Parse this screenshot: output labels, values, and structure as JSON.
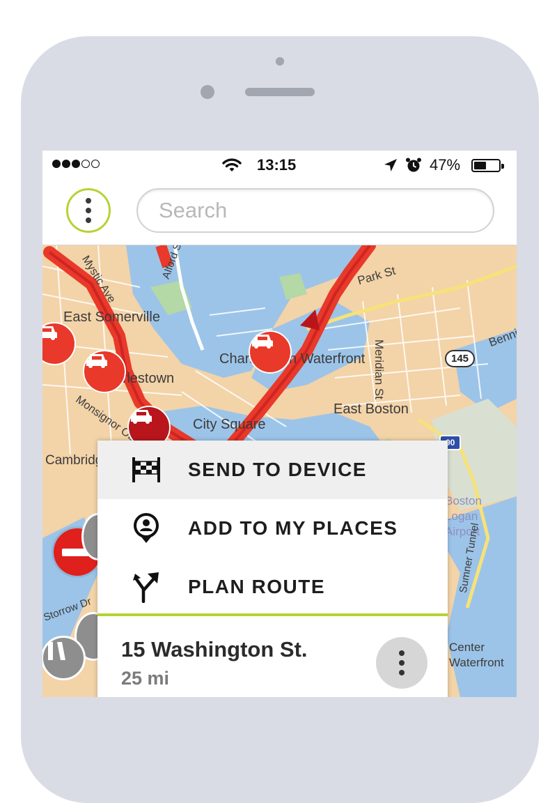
{
  "status_bar": {
    "time": "13:15",
    "battery_percent": "47%",
    "battery_level": 0.47,
    "signal_bars_filled": 3,
    "signal_bars_total": 5,
    "icons": [
      "wifi-icon",
      "location-arrow-icon",
      "alarm-clock-icon",
      "battery-icon"
    ]
  },
  "header": {
    "menu_icon": "more-vertical-icon",
    "search_placeholder": "Search",
    "accent_color": "#b5d334"
  },
  "map": {
    "labels": {
      "east_somerville": "East Somerville",
      "charlestown": "Charlestown",
      "charlestown_waterfront": "Charlestown Waterfront",
      "waterfront": "Waterfront",
      "city_square": "City Square",
      "east_boston": "East Boston",
      "meridian_st": "Meridian St",
      "park_st": "Park St",
      "mystic_ave": "Mystic Ave",
      "monsignor_ob": "Monsignor Ob",
      "cambridge": "Cambridge",
      "storrow_dr": "Storrow Dr",
      "boston_logan_airport": "Boston Logan Airport",
      "sumner_tunnel": "Sumner Tunnel",
      "center_waterfront": "Center Waterfront",
      "bennington": "Benning",
      "alford_st": "Alford St"
    },
    "route_shields": {
      "route_145": "145",
      "interstate_90": "90"
    },
    "traffic_icon": "car-icon",
    "traffic_color": "#e8392a",
    "route_color": "#e8392a"
  },
  "popup_menu": {
    "items": [
      {
        "label": "SEND TO DEVICE",
        "icon": "checkered-flag-icon"
      },
      {
        "label": "ADD TO MY PLACES",
        "icon": "place-pin-icon"
      },
      {
        "label": "PLAN ROUTE",
        "icon": "route-split-icon"
      }
    ],
    "place": {
      "name": "15 Washington St.",
      "distance": "25 mi"
    }
  }
}
